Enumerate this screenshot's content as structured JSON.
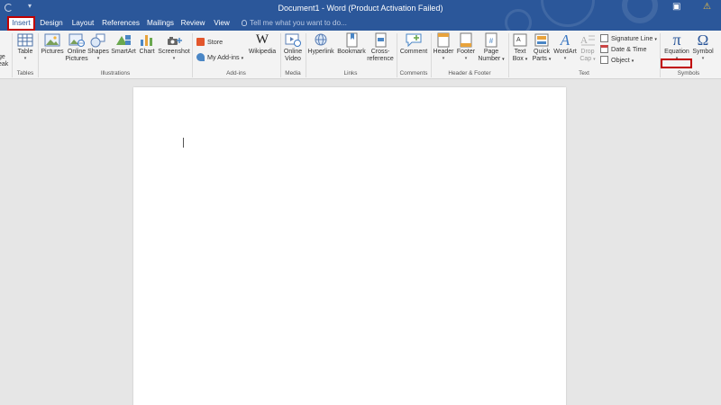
{
  "window": {
    "title": "Document1 - Word (Product Activation Failed)"
  },
  "tabs": [
    {
      "label": "Insert",
      "active": true
    },
    {
      "label": "Design"
    },
    {
      "label": "Layout"
    },
    {
      "label": "References"
    },
    {
      "label": "Mailings"
    },
    {
      "label": "Review"
    },
    {
      "label": "View"
    }
  ],
  "tell_me": {
    "placeholder": "Tell me what you want to do..."
  },
  "ribbon": {
    "pages": {
      "partial_label_top": "ge",
      "partial_label_bottom": "eak"
    },
    "tables": {
      "group": "Tables",
      "table": "Table"
    },
    "illustrations": {
      "group": "Illustrations",
      "pictures": "Pictures",
      "online_pictures_1": "Online",
      "online_pictures_2": "Pictures",
      "shapes": "Shapes",
      "smartart": "SmartArt",
      "chart": "Chart",
      "screenshot": "Screenshot"
    },
    "addins": {
      "group": "Add-ins",
      "store": "Store",
      "my_addins": "My Add-ins",
      "wikipedia": "Wikipedia"
    },
    "media": {
      "group": "Media",
      "online_video_1": "Online",
      "online_video_2": "Video"
    },
    "links": {
      "group": "Links",
      "hyperlink": "Hyperlink",
      "bookmark": "Bookmark",
      "cross_ref_1": "Cross-",
      "cross_ref_2": "reference"
    },
    "comments": {
      "group": "Comments",
      "comment": "Comment"
    },
    "header_footer": {
      "group": "Header & Footer",
      "header": "Header",
      "footer": "Footer",
      "page_number_1": "Page",
      "page_number_2": "Number"
    },
    "text": {
      "group": "Text",
      "text_box_1": "Text",
      "text_box_2": "Box",
      "quick_parts_1": "Quick",
      "quick_parts_2": "Parts",
      "wordart": "WordArt",
      "drop_cap_1": "Drop",
      "drop_cap_2": "Cap",
      "signature_line": "Signature Line",
      "date_time": "Date & Time",
      "object": "Object"
    },
    "symbols": {
      "group": "Symbols",
      "equation": "Equation",
      "symbol": "Symbol",
      "equation_glyph": "π",
      "symbol_glyph": "Ω"
    }
  },
  "colors": {
    "titlebar": "#2b579a",
    "ribbon": "#f3f3f3",
    "highlight": "#c00000",
    "canvas": "#e6e6e6",
    "page": "#ffffff"
  }
}
